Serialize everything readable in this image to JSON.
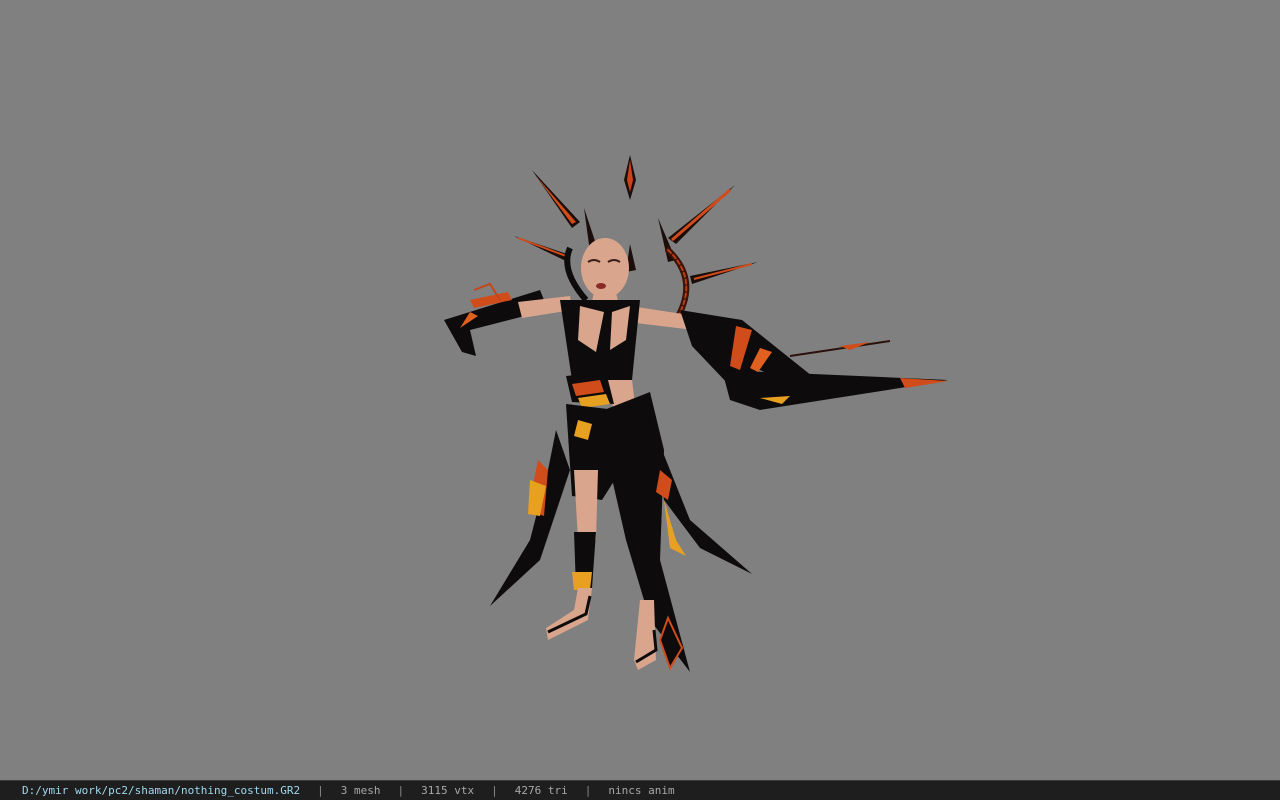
{
  "viewer": {
    "background": "#808080",
    "model_description": "model-preview"
  },
  "status": {
    "file_path": "D:/ymir work/pc2/shaman/nothing_costum.GR2",
    "separator": "|",
    "mesh": "3 mesh",
    "vertices": "3115 vtx",
    "triangles": "4276 tri",
    "animation": "nincs anim"
  },
  "colors": {
    "status_bg": "#1e1e1e",
    "path_text": "#9fd8ee",
    "stat_text": "#a8a8a8",
    "costume_black": "#0d0b0b",
    "costume_orange": "#e0521a",
    "costume_gold": "#e8a020",
    "skin": "#d9a58c"
  }
}
